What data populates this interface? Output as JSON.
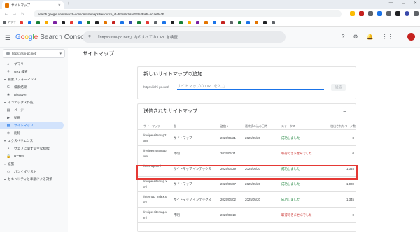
{
  "browser": {
    "tab_title": "サイトマップ",
    "address": "search.google.com/search-console/sitemaps?resource_id=https%3A%2F%2Fishi-pc.net%2F",
    "bookmarks": [
      {
        "label": "アプリ",
        "color": "#5f6368"
      },
      {
        "label": "",
        "color": "#e53935"
      },
      {
        "label": "",
        "color": "#1a73e8"
      },
      {
        "label": "",
        "color": "#188038"
      },
      {
        "label": "",
        "color": "#f9ab00"
      },
      {
        "label": "",
        "color": "#7b1fa2"
      },
      {
        "label": "",
        "color": "#202124"
      },
      {
        "label": "",
        "color": "#e53935"
      },
      {
        "label": "",
        "color": "#1a73e8"
      },
      {
        "label": "",
        "color": "#188038"
      },
      {
        "label": "",
        "color": "#202124"
      },
      {
        "label": "",
        "color": "#e37400"
      },
      {
        "label": "",
        "color": "#c5221f"
      },
      {
        "label": "",
        "color": "#1a73e8"
      },
      {
        "label": "",
        "color": "#3949ab"
      },
      {
        "label": "",
        "color": "#188038"
      },
      {
        "label": "",
        "color": "#e53935"
      },
      {
        "label": "",
        "color": "#5f6368"
      },
      {
        "label": "",
        "color": "#1a73e8"
      },
      {
        "label": "",
        "color": "#202124"
      },
      {
        "label": "",
        "color": "#188038"
      },
      {
        "label": "",
        "color": "#f9ab00"
      },
      {
        "label": "",
        "color": "#7b1fa2"
      },
      {
        "label": "",
        "color": "#e37400"
      },
      {
        "label": "",
        "color": "#1a73e8"
      },
      {
        "label": "",
        "color": "#c5221f"
      },
      {
        "label": "",
        "color": "#5f6368"
      },
      {
        "label": "",
        "color": "#188038"
      },
      {
        "label": "",
        "color": "#1a73e8"
      },
      {
        "label": "",
        "color": "#e37400"
      },
      {
        "label": "",
        "color": "#202124"
      },
      {
        "label": "",
        "color": "#5f6368"
      }
    ]
  },
  "header": {
    "logo_google": [
      "G",
      "o",
      "o",
      "g",
      "l",
      "e"
    ],
    "logo_sub": "Search Console",
    "search_placeholder": "「https://ishi-pc.net/」内のすべての URL を検査"
  },
  "sidebar": {
    "property": "https://ishi-pc.net/",
    "nav": [
      {
        "type": "item",
        "icon": "⌂",
        "label": "サマリー",
        "name": "sidebar-item-summary"
      },
      {
        "type": "item",
        "icon": "⚲",
        "label": "URL 検査",
        "name": "sidebar-item-url-inspection"
      },
      {
        "type": "section",
        "label": "検索パフォーマンス",
        "name": "section-search-performance"
      },
      {
        "type": "item",
        "icon": "G",
        "label": "検索結果",
        "name": "sidebar-item-search-results"
      },
      {
        "type": "item",
        "icon": "✱",
        "label": "Discover",
        "name": "sidebar-item-discover"
      },
      {
        "type": "section",
        "label": "インデックス作成",
        "name": "section-indexing"
      },
      {
        "type": "item",
        "icon": "▤",
        "label": "ページ",
        "name": "sidebar-item-pages"
      },
      {
        "type": "item",
        "icon": "▶",
        "label": "動画",
        "name": "sidebar-item-videos"
      },
      {
        "type": "item",
        "icon": "▦",
        "label": "サイトマップ",
        "name": "sidebar-item-sitemaps",
        "active": true
      },
      {
        "type": "item",
        "icon": "⊘",
        "label": "削除",
        "name": "sidebar-item-removals"
      },
      {
        "type": "section",
        "label": "エクスペリエンス",
        "name": "section-experience"
      },
      {
        "type": "item",
        "icon": "◔",
        "label": "ウェブに関する主な指標",
        "name": "sidebar-item-core-web-vitals"
      },
      {
        "type": "item",
        "icon": "🔒",
        "label": "HTTPS",
        "name": "sidebar-item-https"
      },
      {
        "type": "section",
        "label": "拡張",
        "name": "section-enhancements"
      },
      {
        "type": "item",
        "icon": "◇",
        "label": "パンくずリスト",
        "name": "sidebar-item-breadcrumbs"
      },
      {
        "type": "section",
        "label": "セキュリティと手動による対策",
        "name": "section-security"
      }
    ]
  },
  "main": {
    "page_title": "サイトマップ",
    "add_card": {
      "title": "新しいサイトマップの追加",
      "url_prefix": "https://ishi-pc.net/",
      "input_placeholder": "サイトマップの URL を入力",
      "submit_label": "送信"
    },
    "submitted_card": {
      "title": "送信されたサイトマップ",
      "columns": [
        "サイトマップ",
        "型",
        "送信",
        "最終読み込み日時",
        "ステータス",
        "検出されたページ数"
      ],
      "sort_indicator": "↓",
      "rows": [
        {
          "url": "/recipe-sitemap2.xml",
          "type": "サイトマップ",
          "submitted": "2025/05/21",
          "last_read": "2025/05/20",
          "status": "成功しました",
          "status_kind": "ok",
          "pages": "8"
        },
        {
          "url": "/recipe2-sitemap.xml",
          "type": "不明",
          "submitted": "2025/05/21",
          "last_read": "",
          "status": "取得できませんでした",
          "status_kind": "ng",
          "pages": "0"
        },
        {
          "url": "/sitemap.xml",
          "type": "サイトマップ インデックス",
          "submitted": "2025/04/29",
          "last_read": "2025/05/20",
          "status": "成功しました",
          "status_kind": "ok",
          "pages": "1,345"
        },
        {
          "url": "/recipe-sitemap.xml",
          "type": "サイトマップ",
          "submitted": "2025/04/07",
          "last_read": "2025/05/20",
          "status": "成功しました",
          "status_kind": "ok",
          "pages": "1,000"
        },
        {
          "url": "/sitemap_index.xml",
          "type": "サイトマップ インデックス",
          "submitted": "2025/04/02",
          "last_read": "2025/05/20",
          "status": "成功しました",
          "status_kind": "ok",
          "pages": "1,345"
        },
        {
          "url": "/recipe-sitemap.xml",
          "type": "不明",
          "submitted": "2025/03/19",
          "last_read": "",
          "status": "取得できませんでした",
          "status_kind": "ng",
          "pages": "0"
        }
      ]
    }
  }
}
